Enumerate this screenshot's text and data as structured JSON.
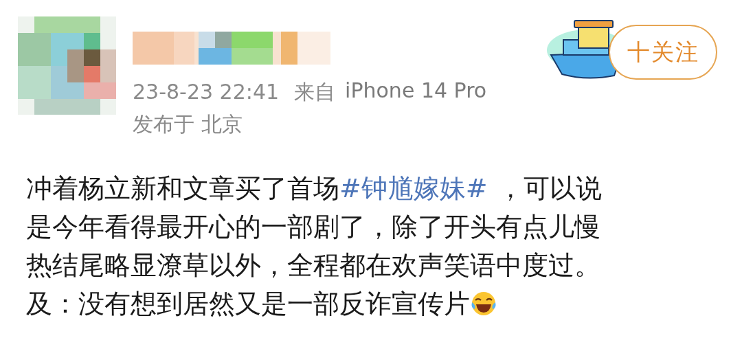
{
  "post_header": {
    "time": "23-8-23 22:41",
    "source_prefix": "来自",
    "source": "iPhone 14 Pro",
    "location": "发布于 北京",
    "follow_button": "十关注"
  },
  "post_body": {
    "lines": [
      [
        {
          "kind": "text",
          "text": "冲着杨立新和文章买了首场"
        },
        {
          "kind": "hashtag",
          "text": "#钟馗嫁妹#"
        },
        {
          "kind": "text",
          "text": "，可以说"
        }
      ],
      [
        {
          "kind": "text",
          "text": "是今年看得最开心的一部剧了，除了开头有点儿慢"
        }
      ],
      [
        {
          "kind": "text",
          "text": "热结尾略显潦草以外，全程都在欢声笑语中度过。"
        }
      ],
      [
        {
          "kind": "text",
          "text": "及：没有想到居然又是一部反诈宣传片"
        },
        {
          "kind": "emoji"
        }
      ]
    ]
  }
}
